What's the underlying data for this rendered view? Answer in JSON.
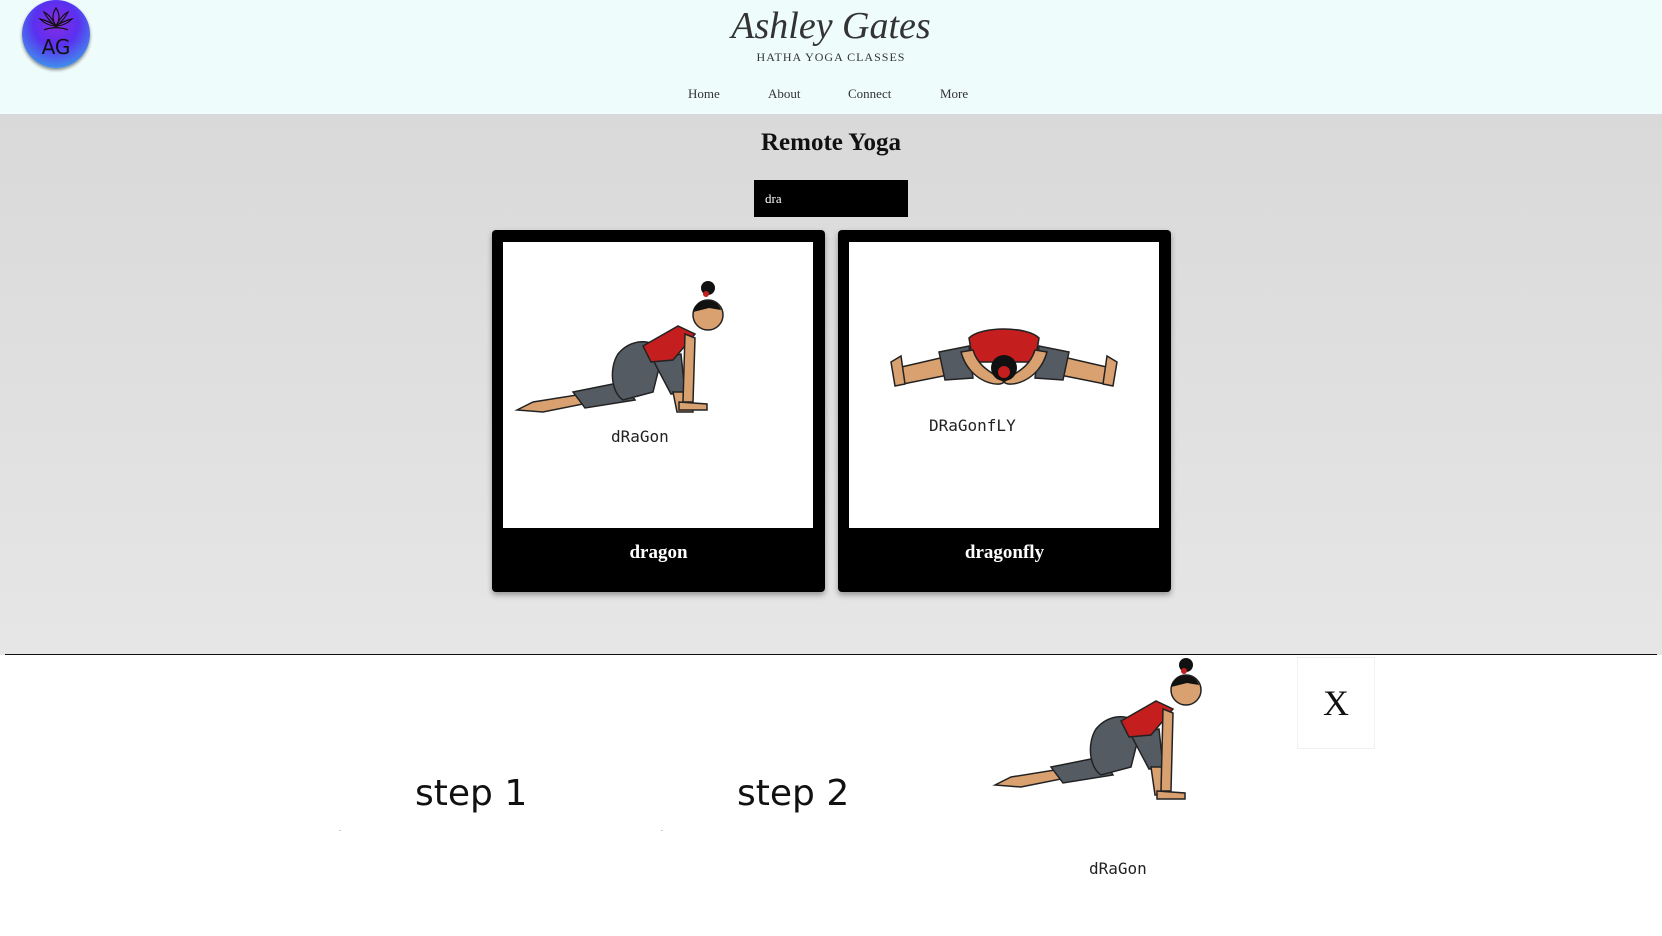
{
  "header": {
    "logo_text": "AG",
    "title": "Ashley Gates",
    "subtitle": "HATHA YOGA CLASSES",
    "nav": [
      "Home",
      "About",
      "Connect",
      "More"
    ]
  },
  "main": {
    "page_title": "Remote Yoga",
    "search": {
      "value": "dra"
    },
    "cards": [
      {
        "label": "dragon",
        "caption": "dRaGon"
      },
      {
        "label": "dragonfly",
        "caption": "DRaGonfLY"
      }
    ]
  },
  "modal": {
    "steps": [
      "step 1",
      "step 2"
    ],
    "pose_caption": "dRaGon",
    "close_label": "X"
  },
  "colors": {
    "header_bg": "#effcfc",
    "card_bg": "#000000",
    "skin": "#d9a070",
    "top": "#c41e1e",
    "pants": "#555b63"
  }
}
